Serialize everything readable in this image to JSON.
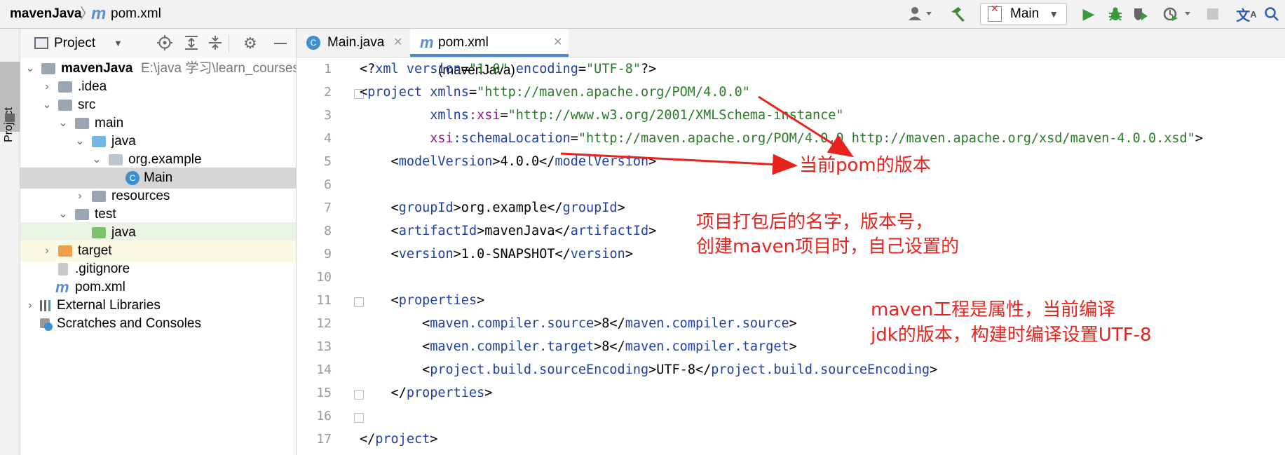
{
  "breadcrumb": {
    "project": "mavenJava",
    "separator": "〉",
    "file": "pom.xml"
  },
  "toolbar": {
    "run_config": "Main"
  },
  "project_panel": {
    "title": "Project",
    "tree": [
      {
        "name": "mavenJava",
        "path": "E:\\java 学习\\learn_courses\\"
      },
      {
        "name": ".idea"
      },
      {
        "name": "src"
      },
      {
        "name": "main"
      },
      {
        "name": "java"
      },
      {
        "name": "org.example"
      },
      {
        "name": "Main"
      },
      {
        "name": "resources"
      },
      {
        "name": "test"
      },
      {
        "name": "java"
      },
      {
        "name": "target"
      },
      {
        "name": ".gitignore"
      },
      {
        "name": "pom.xml"
      },
      {
        "name": "External Libraries"
      },
      {
        "name": "Scratches and Consoles"
      }
    ]
  },
  "tabs": [
    {
      "label": "Main.java"
    },
    {
      "label": "pom.xml (mavenJava)"
    }
  ],
  "editor": {
    "line_numbers": [
      "1",
      "2",
      "3",
      "4",
      "5",
      "6",
      "7",
      "8",
      "9",
      "10",
      "11",
      "12",
      "13",
      "14",
      "15",
      "16",
      "17"
    ],
    "code": {
      "l1_a": "<?",
      "l1_b": "xml version",
      "l1_c": "=",
      "l1_d": "\"1.0\"",
      "l1_e": " encoding",
      "l1_f": "=",
      "l1_g": "\"UTF-8\"",
      "l1_h": "?>",
      "l2_a": "<",
      "l2_b": "project",
      "l2_c": " xmlns",
      "l2_d": "=",
      "l2_e": "\"http://maven.apache.org/POM/4.0.0\"",
      "l3_a": "         xmlns",
      "l3_b": ":xsi",
      "l3_c": "=",
      "l3_d": "\"http://www.w3.org/2001/XMLSchema-instance\"",
      "l4_a": "         xsi",
      "l4_b": ":schemaLocation",
      "l4_c": "=",
      "l4_d": "\"http://maven.apache.org/POM/4.0.0 http://maven.apache.org/xsd/maven-4.0.0.xsd\"",
      "l4_e": ">",
      "l5_a": "    <",
      "l5_b": "modelVersion",
      "l5_c": ">4.0.0</",
      "l5_d": "modelVersion",
      "l5_e": ">",
      "l7_a": "    <",
      "l7_b": "groupId",
      "l7_c": ">org.example</",
      "l7_d": "groupId",
      "l7_e": ">",
      "l8_a": "    <",
      "l8_b": "artifactId",
      "l8_c": ">mavenJava</",
      "l8_d": "artifactId",
      "l8_e": ">",
      "l9_a": "    <",
      "l9_b": "version",
      "l9_c": ">1.0-SNAPSHOT</",
      "l9_d": "version",
      "l9_e": ">",
      "l11_a": "    <",
      "l11_b": "properties",
      "l11_c": ">",
      "l12_a": "        <",
      "l12_b": "maven.compiler.source",
      "l12_c": ">8</",
      "l12_d": "maven.compiler.source",
      "l12_e": ">",
      "l13_a": "        <",
      "l13_b": "maven.compiler.target",
      "l13_c": ">8</",
      "l13_d": "maven.compiler.target",
      "l13_e": ">",
      "l14_a": "        <",
      "l14_b": "project.build.sourceEncoding",
      "l14_c": ">UTF-8</",
      "l14_d": "project.build.sourceEncoding",
      "l14_e": ">",
      "l15_a": "    </",
      "l15_b": "properties",
      "l15_c": ">",
      "l17_a": "</",
      "l17_b": "project",
      "l17_c": ">"
    }
  },
  "annotations": {
    "pom_version": "当前pom的版本",
    "package_line1": "项目打包后的名字，版本号，",
    "package_line2": "创建maven项目时，自己设置的",
    "props_line1": "maven工程是属性，当前编译",
    "props_line2": "jdk的版本，构建时编译设置UTF-8"
  },
  "colors": {
    "annotation": "#e8231e",
    "tag": "#1f3fa8",
    "value": "#2a7a2a",
    "namespace": "#8a1c8a",
    "selected_row": "#d5d5d5",
    "test_row": "#e9f5e2",
    "target_row": "#fbf9e3"
  }
}
